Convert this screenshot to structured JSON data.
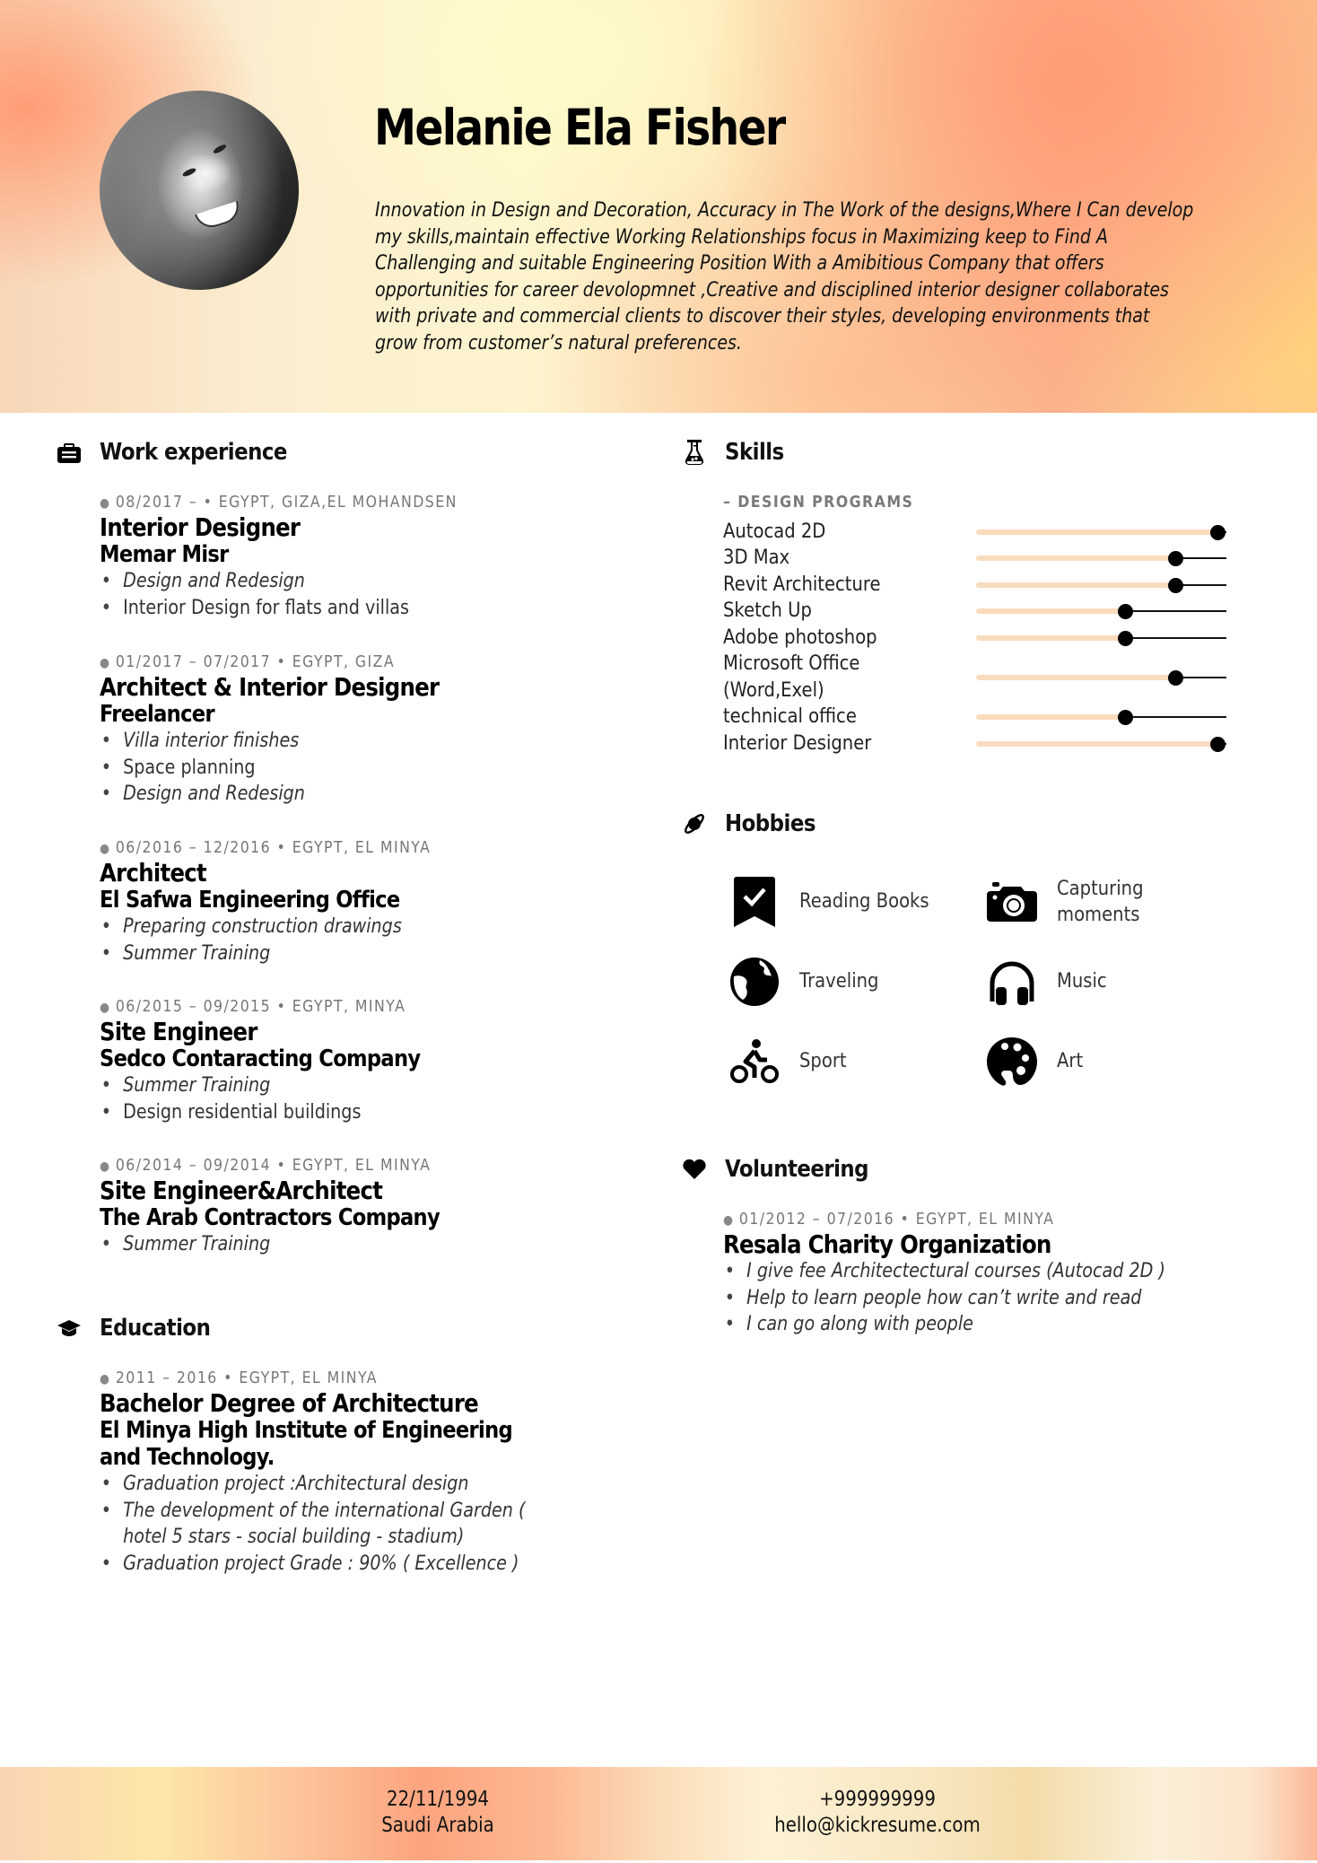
{
  "profile": {
    "name": "Melanie Ela Fisher",
    "photo_alt": "profile-photo",
    "summary": "Innovation in Design and Decoration, Accuracy in The Work of the designs,Where I Can develop my skills,maintain effective Working Relationships focus in Maximizing keep to Find A Challenging and suitable Engineering Position With a Amibitious Company that offers opportunities for career devolopmnet ,Creative and disciplined interior designer collaborates with private and commercial clients to discover their styles, developing environments that grow from customer’s natural preferences."
  },
  "work": {
    "title": "Work experience",
    "icon": "briefcase-icon",
    "entries": [
      {
        "meta": "08/2017 – • EGYPT, GIZA,EL MOHANDSEN",
        "role": "Interior Designer",
        "org": "Memar Misr",
        "bullets": [
          {
            "text": "Design and Redesign",
            "italic": true
          },
          {
            "text": "Interior Design for flats and villas",
            "italic": false
          }
        ]
      },
      {
        "meta": "01/2017 – 07/2017 • EGYPT, GIZA",
        "role": "Architect & Interior Designer",
        "org": "Freelancer",
        "bullets": [
          {
            "text": "Villa interior finishes",
            "italic": true
          },
          {
            "text": "Space planning",
            "italic": false
          },
          {
            "text": "Design and Redesign",
            "italic": true
          }
        ]
      },
      {
        "meta": "06/2016 – 12/2016 • EGYPT, EL MINYA",
        "role": "Architect",
        "org": "El Safwa Engineering Office",
        "bullets": [
          {
            "text": "Preparing construction drawings",
            "italic": true
          },
          {
            "text": "Summer Training",
            "italic": true
          }
        ]
      },
      {
        "meta": "06/2015 – 09/2015 • EGYPT, MINYA",
        "role": "Site Engineer",
        "org": "Sedco Contaracting Company",
        "bullets": [
          {
            "text": "Summer Training",
            "italic": true
          },
          {
            "text": "Design residential buildings",
            "italic": false
          }
        ]
      },
      {
        "meta": "06/2014 – 09/2014 • EGYPT, EL MINYA",
        "role": "Site Engineer&Architect",
        "org": "The Arab Contractors Company",
        "bullets": [
          {
            "text": "Summer Training",
            "italic": true
          }
        ]
      }
    ]
  },
  "education": {
    "title": "Education",
    "icon": "graduation-cap-icon",
    "entries": [
      {
        "meta": "2011 – 2016 • EGYPT, EL MINYA",
        "role": "Bachelor Degree of Architecture",
        "org": "El Minya High Institute of Engineering and Technology.",
        "bullets": [
          {
            "text": "Graduation project :Architectural design",
            "italic": true
          },
          {
            "text": "The development of the international Garden ( hotel 5 stars - social building - stadium)",
            "italic": true
          },
          {
            "text": "Graduation project Grade : 90% ( Excellence )",
            "italic": true
          }
        ]
      }
    ]
  },
  "skills": {
    "title": "Skills",
    "icon": "flask-icon",
    "category": "– DESIGN PROGRAMS",
    "items": [
      {
        "label": "Autocad 2D",
        "level_percent": 100
      },
      {
        "label": "3D Max",
        "level_percent": 80
      },
      {
        "label": "Revit Architecture",
        "level_percent": 80
      },
      {
        "label": "Sketch Up",
        "level_percent": 60
      },
      {
        "label": "Adobe photoshop",
        "level_percent": 60
      },
      {
        "label": "Microsoft Office (Word,Exel)",
        "level_percent": 80
      },
      {
        "label": "technical office",
        "level_percent": 60
      },
      {
        "label": "Interior Designer",
        "level_percent": 100
      }
    ]
  },
  "hobbies": {
    "title": "Hobbies",
    "icon": "planet-icon",
    "items": [
      {
        "label": "Reading Books",
        "icon": "bookmark-check-icon"
      },
      {
        "label": "Capturing moments",
        "icon": "camera-icon"
      },
      {
        "label": "Traveling",
        "icon": "globe-icon"
      },
      {
        "label": "Music",
        "icon": "headphones-icon"
      },
      {
        "label": "Sport",
        "icon": "bicycle-icon"
      },
      {
        "label": "Art",
        "icon": "palette-icon"
      }
    ]
  },
  "volunteering": {
    "title": "Volunteering",
    "icon": "heart-icon",
    "entries": [
      {
        "meta": "01/2012 – 07/2016 • EGYPT, EL MINYA",
        "org": "Resala Charity Organization",
        "bullets": [
          {
            "text": "I give fee Architectectural courses (Autocad 2D )",
            "italic": true
          },
          {
            "text": "Help to learn people how can’t write and read",
            "italic": true
          },
          {
            "text": "I can go along with people",
            "italic": true
          }
        ]
      }
    ]
  },
  "footer": {
    "birth_date": "22/11/1994",
    "location": "Saudi Arabia",
    "phone": "+999999999",
    "email": "hello@kickresume.com"
  },
  "colors": {
    "skill_fill": "#f9dcbd",
    "skill_knob": "#000000",
    "meta_text": "#777777"
  }
}
